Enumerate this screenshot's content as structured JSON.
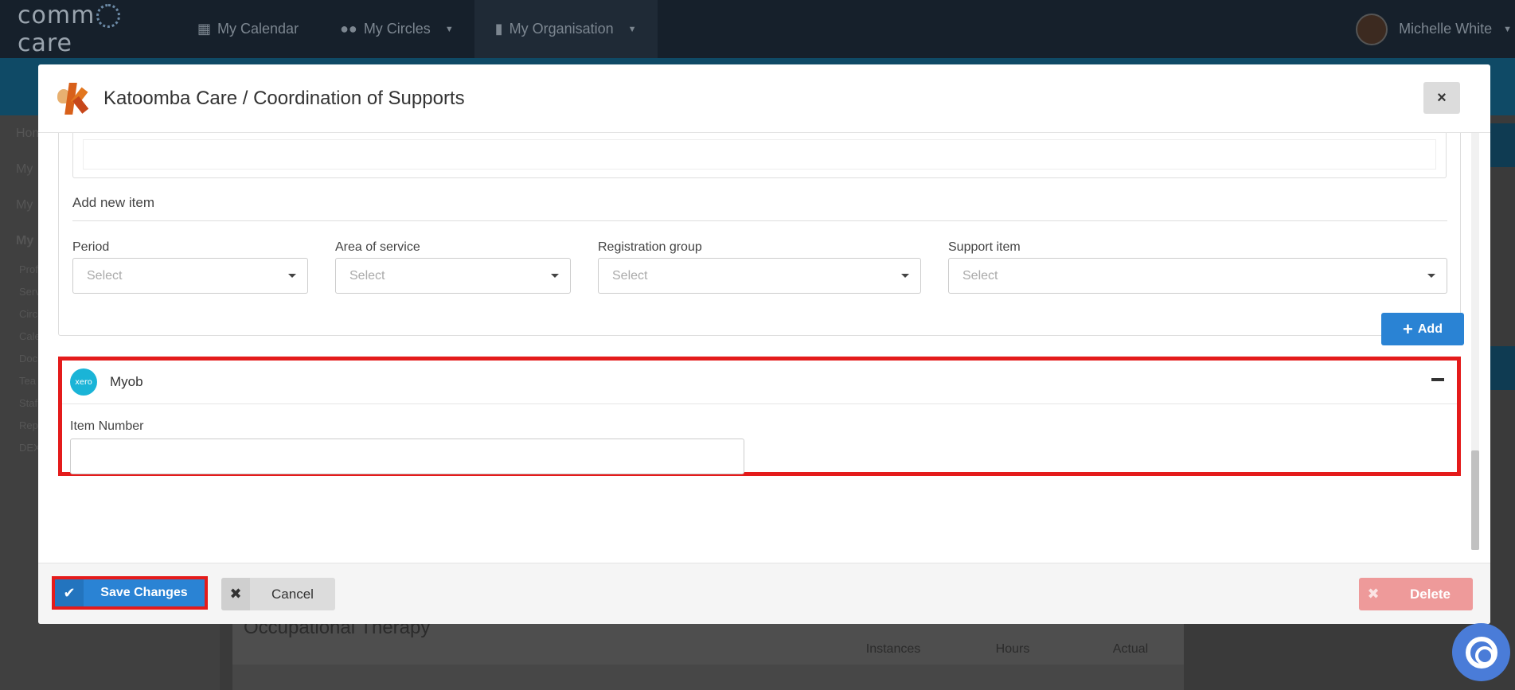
{
  "topnav": {
    "logo": "comm care",
    "items": [
      {
        "label": "My Calendar",
        "icon": "calendar-icon"
      },
      {
        "label": "My Circles",
        "icon": "users-icon"
      },
      {
        "label": "My Organisation",
        "icon": "building-icon"
      }
    ],
    "user_name": "Michelle White"
  },
  "sidebar": {
    "links": [
      "Hom",
      "My",
      "My",
      "My"
    ],
    "sublinks": [
      "Prof",
      "Serv",
      "Circ",
      "Cale",
      "Doc",
      "Tea",
      "Staf",
      "Rep",
      "DEX"
    ]
  },
  "background": {
    "card_title": "Occupational Therapy",
    "stats": [
      "Instances",
      "Hours",
      "Actual"
    ]
  },
  "modal": {
    "title": "Katoomba Care / Coordination of Supports",
    "close": "×",
    "add_new_item": "Add new item",
    "fields": [
      {
        "label": "Period",
        "placeholder": "Select"
      },
      {
        "label": "Area of service",
        "placeholder": "Select"
      },
      {
        "label": "Registration group",
        "placeholder": "Select"
      },
      {
        "label": "Support item",
        "placeholder": "Select"
      }
    ],
    "add_button": "Add",
    "integration": {
      "logo_text": "xero",
      "title": "Myob",
      "item_number_label": "Item Number",
      "item_number_value": ""
    },
    "footer": {
      "save": "Save Changes",
      "cancel": "Cancel",
      "delete": "Delete"
    }
  },
  "colors": {
    "primary": "#2a83d4",
    "highlight": "#e41b1b",
    "delete": "#ee9a9a",
    "xero": "#1ab4d7"
  }
}
